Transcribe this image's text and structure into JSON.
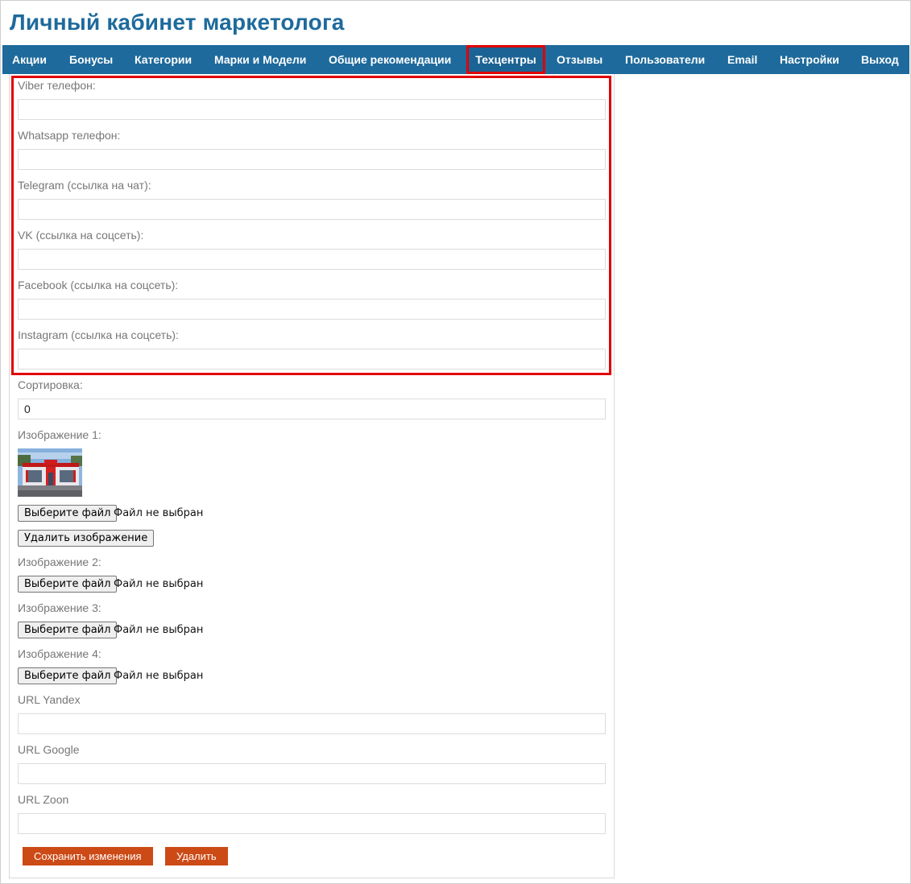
{
  "header": {
    "title": "Личный кабинет маркетолога"
  },
  "nav": {
    "items": [
      {
        "label": "Акции"
      },
      {
        "label": "Бонусы"
      },
      {
        "label": "Категории"
      },
      {
        "label": "Марки и Модели"
      },
      {
        "label": "Общие рекомендации"
      },
      {
        "label": "Техцентры",
        "active": true
      },
      {
        "label": "Отзывы"
      },
      {
        "label": "Пользователи"
      },
      {
        "label": "Email"
      },
      {
        "label": "Настройки"
      },
      {
        "label": "Выход"
      }
    ]
  },
  "form": {
    "fields": [
      {
        "label": "Viber телефон:",
        "value": ""
      },
      {
        "label": "Whatsapp телефон:",
        "value": ""
      },
      {
        "label": "Telegram (ссылка на чат):",
        "value": ""
      },
      {
        "label": "VK (ссылка на соцсеть):",
        "value": ""
      },
      {
        "label": "Facebook (ссылка на соцсеть):",
        "value": ""
      },
      {
        "label": "Instagram (ссылка на соцсеть):",
        "value": ""
      },
      {
        "label": "Сортировка:",
        "value": "0"
      }
    ],
    "images": [
      {
        "label": "Изображение 1:",
        "choose_label": "Выберите файл",
        "status": "Файл не выбран",
        "delete_label": "Удалить изображение"
      },
      {
        "label": "Изображение 2:",
        "choose_label": "Выберите файл",
        "status": "Файл не выбран"
      },
      {
        "label": "Изображение 3:",
        "choose_label": "Выберите файл",
        "status": "Файл не выбран"
      },
      {
        "label": "Изображение 4:",
        "choose_label": "Выберите файл",
        "status": "Файл не выбран"
      }
    ],
    "urls": [
      {
        "label": "URL Yandex",
        "value": ""
      },
      {
        "label": "URL Google",
        "value": ""
      },
      {
        "label": "URL Zoon",
        "value": ""
      }
    ],
    "save_label": "Сохранить изменения",
    "delete_label": "Удалить"
  },
  "colors": {
    "brand": "#1e6a9c",
    "highlight": "#e00000",
    "action": "#cc4a16"
  }
}
